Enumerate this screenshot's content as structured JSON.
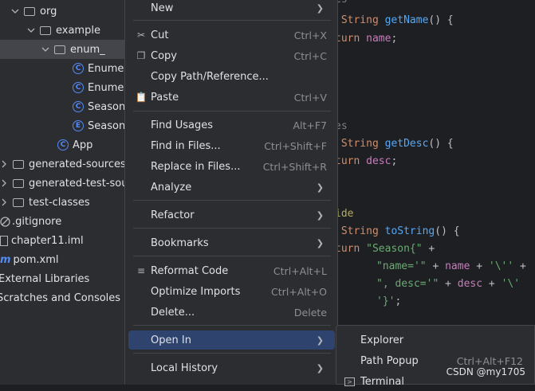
{
  "project_tree": [
    {
      "label": "org",
      "kind": "folder"
    },
    {
      "label": "example",
      "kind": "folder"
    },
    {
      "label": "enum_",
      "kind": "folder"
    },
    {
      "label": "Enumer",
      "kind": "class"
    },
    {
      "label": "Enumer",
      "kind": "class"
    },
    {
      "label": "Season",
      "kind": "class"
    },
    {
      "label": "Season",
      "kind": "enum"
    },
    {
      "label": "App",
      "kind": "class"
    },
    {
      "label": "generated-sources",
      "kind": "folder"
    },
    {
      "label": "generated-test-sou",
      "kind": "folder"
    },
    {
      "label": "test-classes",
      "kind": "folder"
    },
    {
      "label": ".gitignore",
      "kind": "file"
    },
    {
      "label": "chapter11.iml",
      "kind": "file"
    },
    {
      "label": "pom.xml",
      "kind": "maven"
    },
    {
      "label": "External Libraries",
      "kind": "lib"
    },
    {
      "label": "Scratches and Consoles",
      "kind": "scratch"
    }
  ],
  "class_badge": "C",
  "enum_badge": "E",
  "maven_badge": "m",
  "code": {
    "l1": "es",
    "l2a": " String ",
    "l2b": "getName",
    "l2c": "() {",
    "l3a": "turn ",
    "l3b": "name",
    "l3c": ";",
    "l4": "es",
    "l5a": " String ",
    "l5b": "getDesc",
    "l5c": "() {",
    "l6a": "turn ",
    "l6b": "desc",
    "l6c": ";",
    "l7": "ide",
    "l8a": " String ",
    "l8b": "toString",
    "l8c": "() {",
    "l9a": "turn ",
    "l9b": "\"Season{\"",
    "l9c": " +",
    "l10a": "\"name='\"",
    "l10b": " + ",
    "l10c": "name",
    "l10d": " + ",
    "l10e": "'\\''",
    "l10f": " +",
    "l11a": "\", desc='\"",
    "l11b": " + ",
    "l11c": "desc",
    "l11d": " + ",
    "l11e": "'\\'",
    "l12a": "'}'",
    "l12b": ";"
  },
  "menu": {
    "new": "New",
    "cut": "Cut",
    "cut_sc": "Ctrl+X",
    "copy": "Copy",
    "copy_sc": "Ctrl+C",
    "copy_path": "Copy Path/Reference...",
    "paste": "Paste",
    "paste_sc": "Ctrl+V",
    "find_usages": "Find Usages",
    "find_usages_sc": "Alt+F7",
    "find_in_files": "Find in Files...",
    "find_in_files_sc": "Ctrl+Shift+F",
    "replace_in_files": "Replace in Files...",
    "replace_in_files_sc": "Ctrl+Shift+R",
    "analyze": "Analyze",
    "refactor": "Refactor",
    "bookmarks": "Bookmarks",
    "reformat": "Reformat Code",
    "reformat_sc": "Ctrl+Alt+L",
    "optimize": "Optimize Imports",
    "optimize_sc": "Ctrl+Alt+O",
    "delete": "Delete...",
    "delete_sc": "Delete",
    "open_in": "Open In",
    "local_history": "Local History"
  },
  "submenu": {
    "explorer": "Explorer",
    "path_popup": "Path Popup",
    "path_popup_sc": "Ctrl+Alt+F12",
    "terminal": "Terminal"
  },
  "watermark": "CSDN @my1705",
  "colors": {
    "highlight": "#2e436e",
    "background": "#2b2d30"
  }
}
